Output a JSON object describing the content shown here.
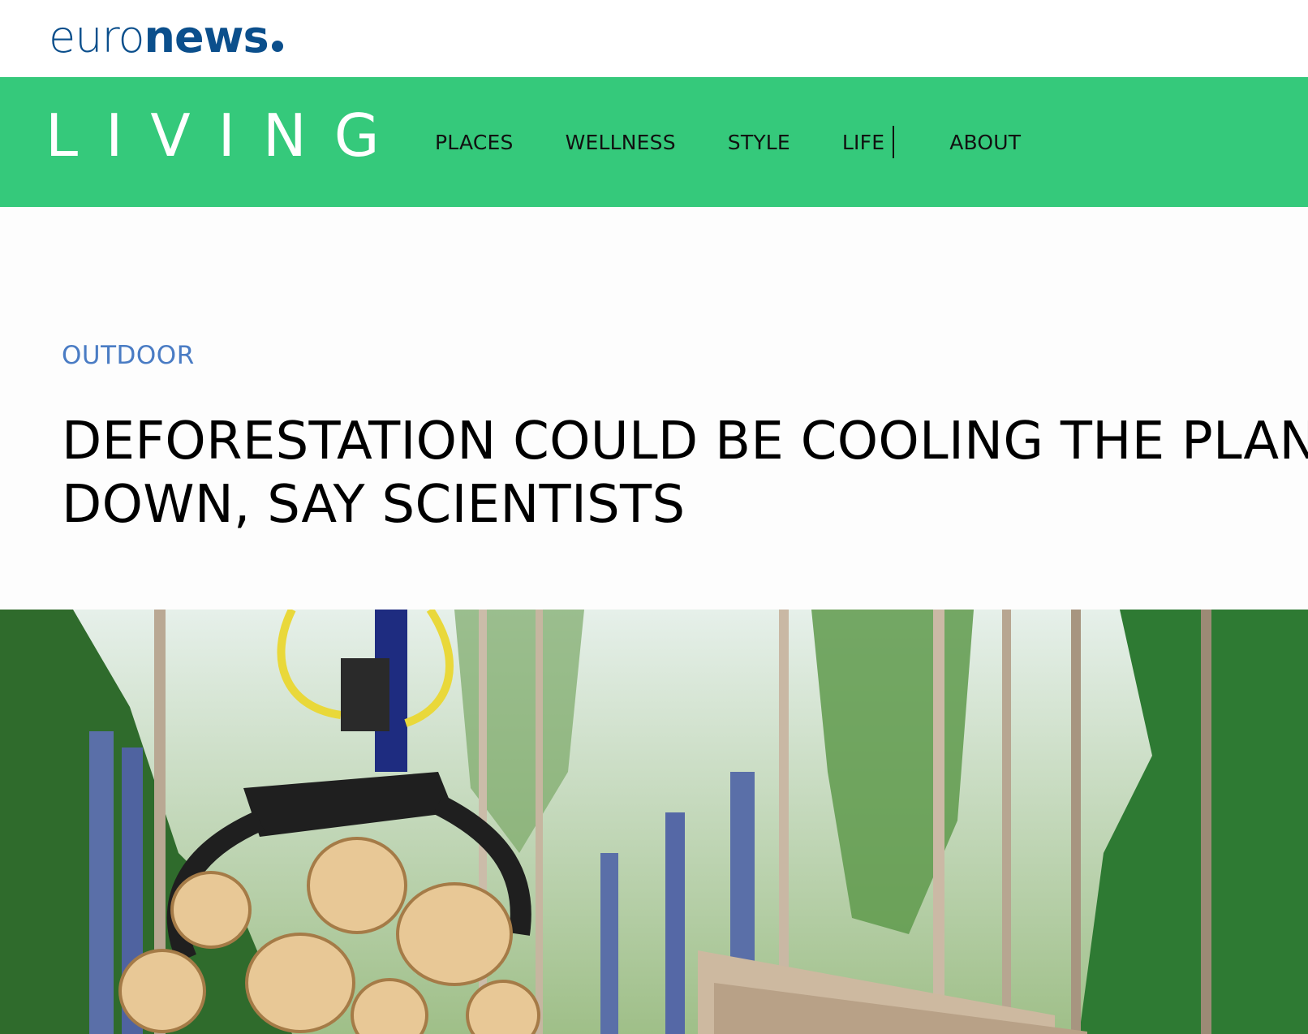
{
  "brand": {
    "euro": "euro",
    "news": "news",
    "color": "#0b4f8c"
  },
  "living_bar": {
    "title": "LIVING",
    "background": "#35c97b",
    "nav": [
      {
        "label": "PLACES"
      },
      {
        "label": "WELLNESS"
      },
      {
        "label": "STYLE"
      },
      {
        "label": "LIFE"
      },
      {
        "label": "ABOUT"
      }
    ]
  },
  "article": {
    "category": "OUTDOOR",
    "category_color": "#4a7cc4",
    "headline_line1": "DEFORESTATION COULD BE COOLING THE PLANET",
    "headline_line2": "DOWN, SAY SCIENTISTS"
  },
  "hero_image": {
    "icon": "forest-logging-photo"
  }
}
